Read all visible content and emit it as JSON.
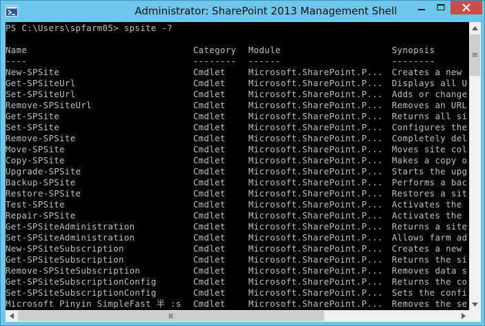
{
  "window": {
    "title": "Administrator: SharePoint 2013 Management Shell",
    "icons": {
      "app": "powershell-icon",
      "minimize": "minimize-icon",
      "maximize": "maximize-icon",
      "close": "close-icon"
    },
    "colors": {
      "titlebar": "#6ec6ea",
      "close": "#c7504b",
      "console_bg": "#000000",
      "console_fg": "#c0c0c0"
    }
  },
  "console": {
    "prompt": "PS C:\\Users\\spfarm05> spsite -?",
    "headers": {
      "name": "Name",
      "category": "Category",
      "module": "Module",
      "synopsis": "Synopsis"
    },
    "underlines": {
      "name": "----",
      "category": "--------",
      "module": "------",
      "synopsis": "--------"
    },
    "rows": [
      {
        "name": "New-SPSite",
        "category": "Cmdlet",
        "module": "Microsoft.SharePoint.P...",
        "synopsis": "Creates a new"
      },
      {
        "name": "Get-SPSiteUrl",
        "category": "Cmdlet",
        "module": "Microsoft.SharePoint.P...",
        "synopsis": "Displays all U"
      },
      {
        "name": "Set-SPSiteUrl",
        "category": "Cmdlet",
        "module": "Microsoft.SharePoint.P...",
        "synopsis": "Adds or change"
      },
      {
        "name": "Remove-SPSiteUrl",
        "category": "Cmdlet",
        "module": "Microsoft.SharePoint.P...",
        "synopsis": "Removes an URL"
      },
      {
        "name": "Get-SPSite",
        "category": "Cmdlet",
        "module": "Microsoft.SharePoint.P...",
        "synopsis": "Returns all si"
      },
      {
        "name": "Set-SPSite",
        "category": "Cmdlet",
        "module": "Microsoft.SharePoint.P...",
        "synopsis": "Configures the"
      },
      {
        "name": "Remove-SPSite",
        "category": "Cmdlet",
        "module": "Microsoft.SharePoint.P...",
        "synopsis": "Completely del"
      },
      {
        "name": "Move-SPSite",
        "category": "Cmdlet",
        "module": "Microsoft.SharePoint.P...",
        "synopsis": "Moves site col"
      },
      {
        "name": "Copy-SPSite",
        "category": "Cmdlet",
        "module": "Microsoft.SharePoint.P...",
        "synopsis": "Makes a copy o"
      },
      {
        "name": "Upgrade-SPSite",
        "category": "Cmdlet",
        "module": "Microsoft.SharePoint.P...",
        "synopsis": "Starts the upg"
      },
      {
        "name": "Backup-SPSite",
        "category": "Cmdlet",
        "module": "Microsoft.SharePoint.P...",
        "synopsis": "Performs a bac"
      },
      {
        "name": "Restore-SPSite",
        "category": "Cmdlet",
        "module": "Microsoft.SharePoint.P...",
        "synopsis": "Restores a sit"
      },
      {
        "name": "Test-SPSite",
        "category": "Cmdlet",
        "module": "Microsoft.SharePoint.P...",
        "synopsis": "Activates the"
      },
      {
        "name": "Repair-SPSite",
        "category": "Cmdlet",
        "module": "Microsoft.SharePoint.P...",
        "synopsis": "Activates the"
      },
      {
        "name": "Get-SPSiteAdministration",
        "category": "Cmdlet",
        "module": "Microsoft.SharePoint.P...",
        "synopsis": "Returns a site"
      },
      {
        "name": "Set-SPSiteAdministration",
        "category": "Cmdlet",
        "module": "Microsoft.SharePoint.P...",
        "synopsis": "Allows farm ad"
      },
      {
        "name": "New-SPSiteSubscription",
        "category": "Cmdlet",
        "module": "Microsoft.SharePoint.P...",
        "synopsis": "Creates a new"
      },
      {
        "name": "Get-SPSiteSubscription",
        "category": "Cmdlet",
        "module": "Microsoft.SharePoint.P...",
        "synopsis": "Returns the si"
      },
      {
        "name": "Remove-SPSiteSubscription",
        "category": "Cmdlet",
        "module": "Microsoft.SharePoint.P...",
        "synopsis": "Removes data s"
      },
      {
        "name": "Get-SPSiteSubscriptionConfig",
        "category": "Cmdlet",
        "module": "Microsoft.SharePoint.P...",
        "synopsis": "Returns the co"
      },
      {
        "name": "Set-SPSiteSubscriptionConfig",
        "category": "Cmdlet",
        "module": "Microsoft.SharePoint.P...",
        "synopsis": "Sets the confi"
      },
      {
        "name": "Microsoft Pinyin SimpleFast 半 :s",
        "category": "Cmdlet",
        "module": "Microsoft.SharePoint.P...",
        "synopsis": "Removes the se"
      }
    ]
  },
  "scrollbars": {
    "vertical": {
      "up": "arrow-up-icon",
      "down": "arrow-down-icon"
    },
    "horizontal": {
      "left": "arrow-left-icon",
      "right": "arrow-right-icon"
    }
  }
}
